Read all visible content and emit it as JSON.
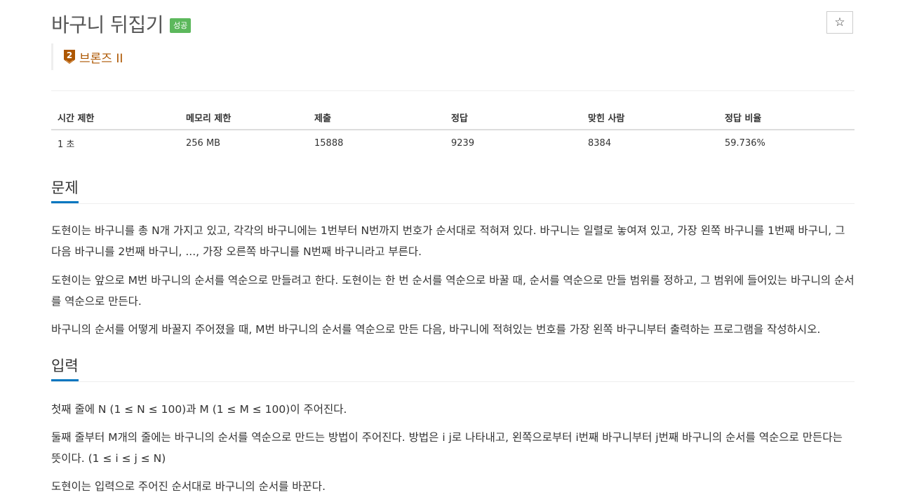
{
  "problem": {
    "title": "바구니 뒤집기",
    "status_badge": "성공",
    "tier_number": "2",
    "tier_label": "브론즈 II"
  },
  "toolbar": {
    "star_glyph": "☆"
  },
  "info_table": {
    "headers": [
      "시간 제한",
      "메모리 제한",
      "제출",
      "정답",
      "맞힌 사람",
      "정답 비율"
    ],
    "values": [
      "1 초",
      "256 MB",
      "15888",
      "9239",
      "8384",
      "59.736%"
    ]
  },
  "description": {
    "heading": "문제",
    "paragraphs": [
      "도현이는 바구니를 총 N개 가지고 있고, 각각의 바구니에는 1번부터 N번까지 번호가 순서대로 적혀져 있다. 바구니는 일렬로 놓여져 있고, 가장 왼쪽 바구니를 1번째 바구니, 그 다음 바구니를 2번째 바구니, ..., 가장 오른쪽 바구니를 N번째 바구니라고 부른다.",
      "도현이는 앞으로 M번 바구니의 순서를 역순으로 만들려고 한다. 도현이는 한 번 순서를 역순으로 바꿀 때, 순서를 역순으로 만들 범위를 정하고, 그 범위에 들어있는 바구니의 순서를 역순으로 만든다.",
      "바구니의 순서를 어떻게 바꿀지 주어졌을 때, M번 바구니의 순서를 역순으로 만든 다음, 바구니에 적혀있는 번호를 가장 왼쪽 바구니부터 출력하는 프로그램을 작성하시오."
    ]
  },
  "input": {
    "heading": "입력",
    "paragraphs": [
      "첫째 줄에 N (1 ≤ N ≤ 100)과 M (1 ≤ M ≤ 100)이 주어진다.",
      "둘째 줄부터 M개의 줄에는 바구니의 순서를 역순으로 만드는 방법이 주어진다. 방법은 i j로 나타내고, 왼쪽으로부터 i번째 바구니부터 j번째 바구니의 순서를 역순으로 만든다는 뜻이다. (1 ≤ i ≤ j ≤ N)",
      "도현이는 입력으로 주어진 순서대로 바구니의 순서를 바꾼다."
    ]
  },
  "colors": {
    "accent_underline": "#0076c0",
    "success_badge": "#5cb85c",
    "bronze": "#ad5600"
  }
}
